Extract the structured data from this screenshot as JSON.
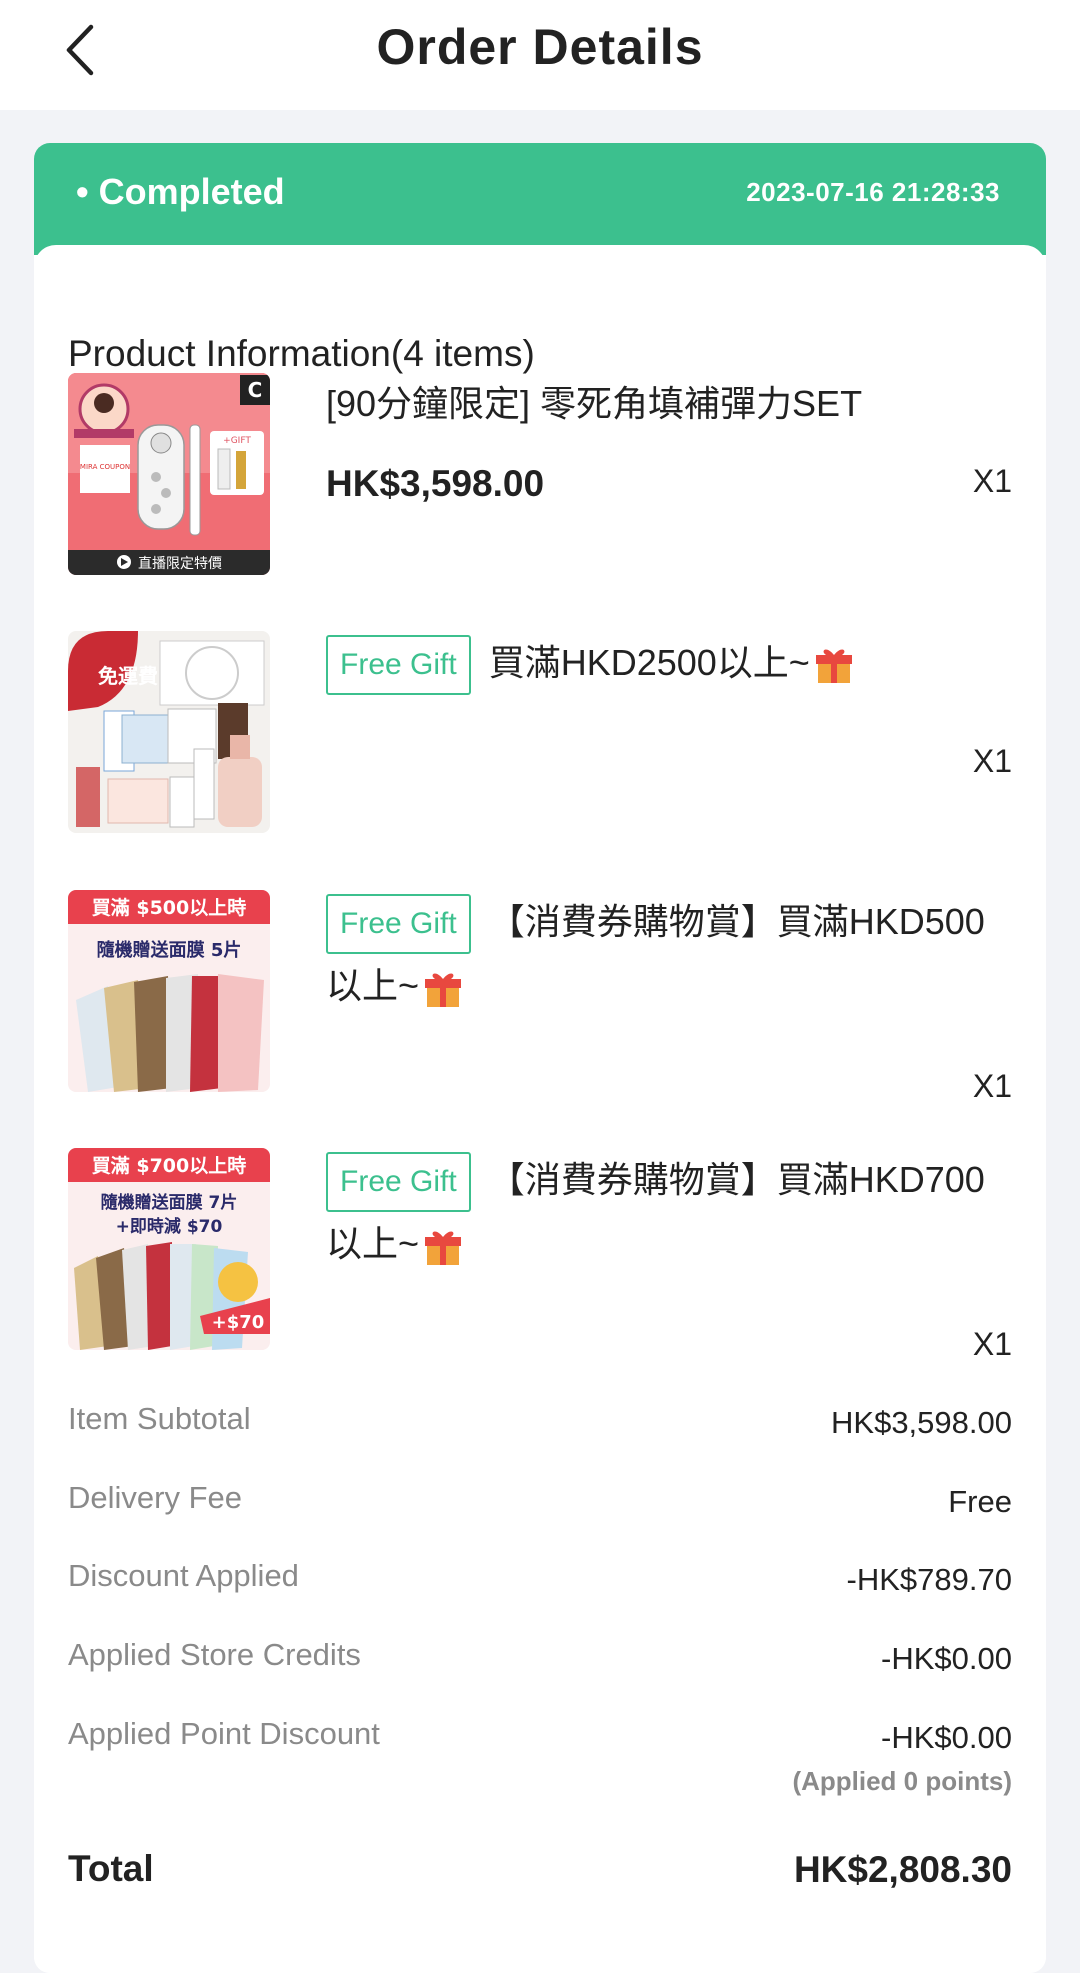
{
  "header": {
    "title": "Order Details",
    "back_icon": "chevron-left-icon"
  },
  "order": {
    "status": "• Completed",
    "timestamp": "2023-07-16 21:28:33",
    "status_color": "#3cc08e"
  },
  "products": {
    "section_title": "Product Information(4 items)",
    "items": [
      {
        "name": "[90分鐘限定] 零死角填補彈力SET",
        "price": "HK$3,598.00",
        "qty": "X1",
        "thumb_badge": "C",
        "thumb_caption": "直播限定特價",
        "thumb_gift": "+GIFT",
        "thumb_coupon": "MIRA COUPON"
      },
      {
        "tag": "Free Gift",
        "name": "買滿HKD2500以上~",
        "qty": "X1",
        "thumb_title": "免運費"
      },
      {
        "tag": "Free Gift",
        "name": "【消費券購物賞】買滿HKD500以上~",
        "qty": "X1",
        "thumb_title": "買滿 $500以上時",
        "thumb_subtitle": "隨機贈送面膜 5片"
      },
      {
        "tag": "Free Gift",
        "name": "【消費券購物賞】買滿HKD700以上~",
        "qty": "X1",
        "thumb_title": "買滿 $700以上時",
        "thumb_subtitle": "隨機贈送面膜 7片",
        "thumb_subtitle2": "+即時減 $70",
        "thumb_badge": "+$70"
      }
    ]
  },
  "summary": {
    "subtotal_label": "Item Subtotal",
    "subtotal_value": "HK$3,598.00",
    "delivery_label": "Delivery Fee",
    "delivery_value": "Free",
    "discount_label": "Discount Applied",
    "discount_value": "-HK$789.70",
    "credits_label": "Applied Store Credits",
    "credits_value": "-HK$0.00",
    "points_label": "Applied Point Discount",
    "points_value": "-HK$0.00",
    "points_note": "(Applied 0 points)",
    "total_label": "Total",
    "total_value": "HK$2,808.30"
  }
}
